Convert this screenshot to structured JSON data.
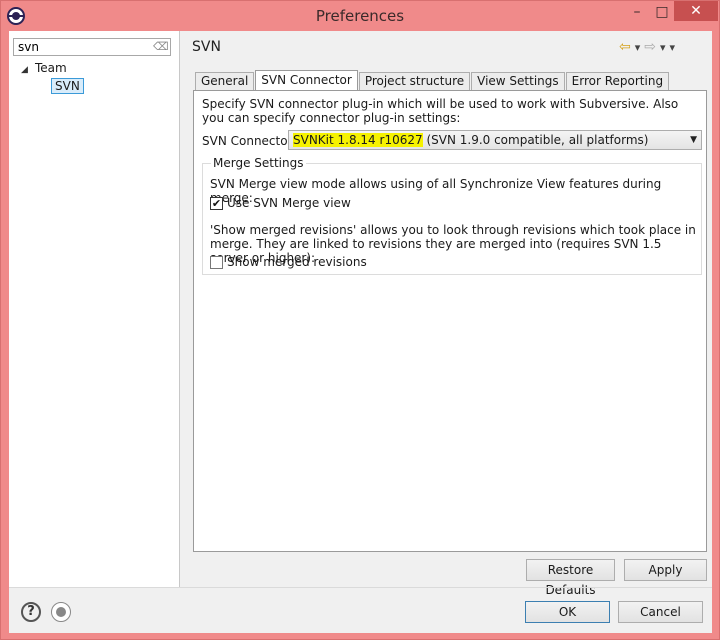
{
  "window": {
    "title": "Preferences"
  },
  "filter": {
    "value": "svn"
  },
  "tree": {
    "items": [
      {
        "label": "Team"
      },
      {
        "label": "SVN"
      }
    ]
  },
  "page": {
    "title": "SVN"
  },
  "tabs": [
    {
      "label": "General"
    },
    {
      "label": "SVN Connector"
    },
    {
      "label": "Project structure"
    },
    {
      "label": "View Settings"
    },
    {
      "label": "Error Reporting"
    }
  ],
  "connector": {
    "description": "Specify SVN connector plug-in which will be used to work with Subversive. Also you can specify connector plug-in settings:",
    "label": "SVN Connector:",
    "selected_highlight": "SVNKit 1.8.14 r10627",
    "selected_rest": " (SVN 1.9.0 compatible, all platforms)"
  },
  "merge": {
    "group_title": "Merge Settings",
    "line1": "SVN Merge view mode allows using of all Synchronize View features during merge:",
    "use_svn_merge_label": "Use SVN Merge view",
    "use_svn_merge_checked": true,
    "paragraph": "'Show merged revisions' allows you to look through revisions which took place in merge. They are linked to revisions they are merged into (requires SVN 1.5 server or higher):",
    "show_merged_label": "Show merged revisions",
    "show_merged_checked": false
  },
  "buttons": {
    "restore_defaults": "Restore Defaults",
    "apply": "Apply",
    "ok": "OK",
    "cancel": "Cancel"
  },
  "icons": {
    "app": "eclipse-icon",
    "help": "help-icon",
    "record": "record-icon",
    "back": "back-arrow-icon",
    "forward": "forward-arrow-icon"
  },
  "colors": {
    "titlebar": "#f08a8a",
    "close_button": "#c75050",
    "highlight": "#f6f200",
    "selection": "#d9ecfa"
  }
}
